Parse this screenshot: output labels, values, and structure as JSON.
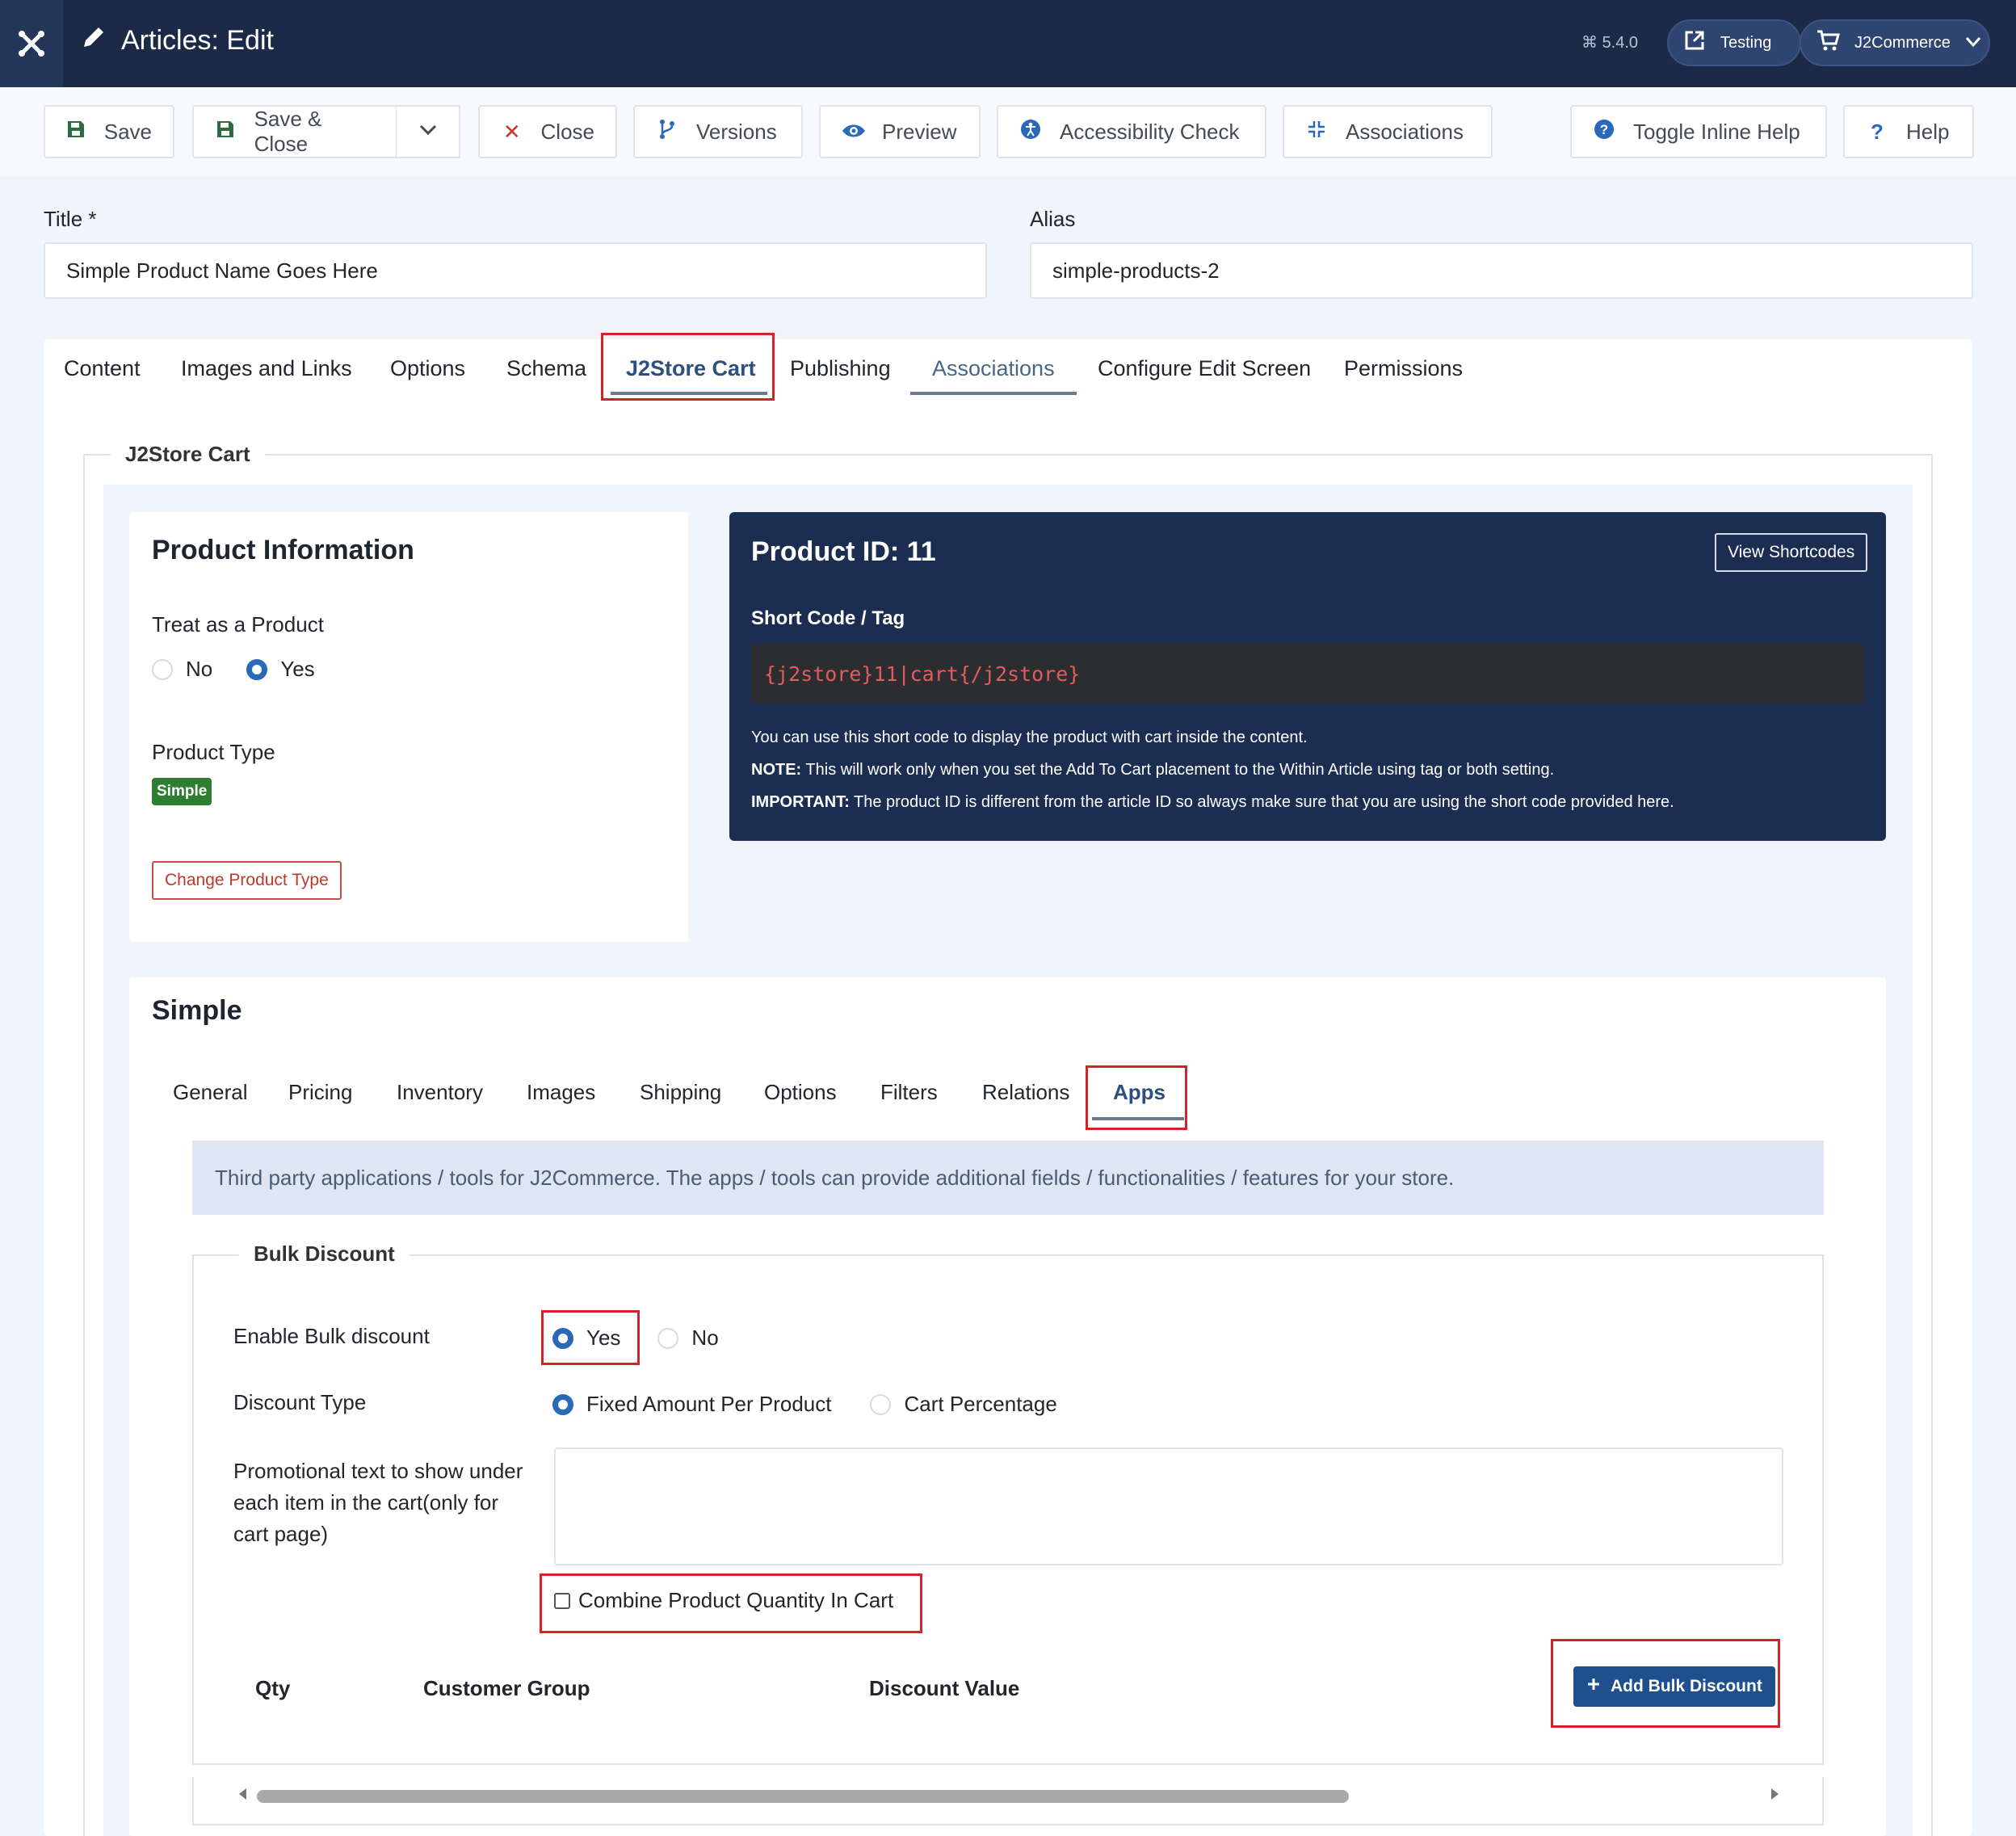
{
  "header": {
    "title": "Articles: Edit",
    "version": "5.4.0",
    "site_button": "Testing",
    "user_menu": "J2Commerce"
  },
  "toolbar": {
    "save": "Save",
    "save_close": "Save & Close",
    "close": "Close",
    "versions": "Versions",
    "preview": "Preview",
    "accessibility": "Accessibility Check",
    "associations": "Associations",
    "toggle_help": "Toggle Inline Help",
    "help": "Help"
  },
  "form": {
    "title_label": "Title *",
    "title_value": "Simple Product Name Goes Here",
    "alias_label": "Alias",
    "alias_value": "simple-products-2"
  },
  "tabs": [
    "Content",
    "Images and Links",
    "Options",
    "Schema",
    "J2Store Cart",
    "Publishing",
    "Associations",
    "Configure Edit Screen",
    "Permissions"
  ],
  "j2store": {
    "legend": "J2Store Cart",
    "product_info": {
      "heading": "Product Information",
      "treat_label": "Treat as a Product",
      "no": "No",
      "yes": "Yes",
      "type_label": "Product Type",
      "type_badge": "Simple",
      "change_button": "Change Product Type"
    },
    "product_card": {
      "heading": "Product ID: 11",
      "view_shortcodes": "View Shortcodes",
      "shortcode_label": "Short Code / Tag",
      "shortcode": "{j2store}11|cart{/j2store}",
      "line1": "You can use this short code to display the product with cart inside the content.",
      "note_label": "NOTE:",
      "note_text": " This will work only when you set the Add To Cart placement to the Within Article using tag or both setting.",
      "important_label": "IMPORTANT:",
      "important_text": " The product ID is different from the article ID so always make sure that you are using the short code provided here."
    },
    "simple": {
      "heading": "Simple",
      "subtabs": [
        "General",
        "Pricing",
        "Inventory",
        "Images",
        "Shipping",
        "Options",
        "Filters",
        "Relations",
        "Apps"
      ],
      "apps_info": "Third party applications / tools for J2Commerce. The apps / tools can provide additional fields / functionalities / features for your store.",
      "bulk": {
        "legend": "Bulk Discount",
        "enable_label": "Enable Bulk discount",
        "yes": "Yes",
        "no": "No",
        "type_label": "Discount Type",
        "type_fixed": "Fixed Amount Per Product",
        "type_percent": "Cart Percentage",
        "promo_label_1": "Promotional text to show under",
        "promo_label_2": "each item in the cart(only for",
        "promo_label_3": "cart page)",
        "promo_value": "",
        "combine_label": "Combine Product Quantity In Cart",
        "col_qty": "Qty",
        "col_group": "Customer Group",
        "col_value": "Discount Value",
        "add_button": "Add Bulk Discount"
      }
    }
  },
  "colors": {
    "header_bg": "#1c2a48",
    "highlight": "#d2232a",
    "primary": "#1f4f8c",
    "radio_on": "#2a69b8"
  }
}
